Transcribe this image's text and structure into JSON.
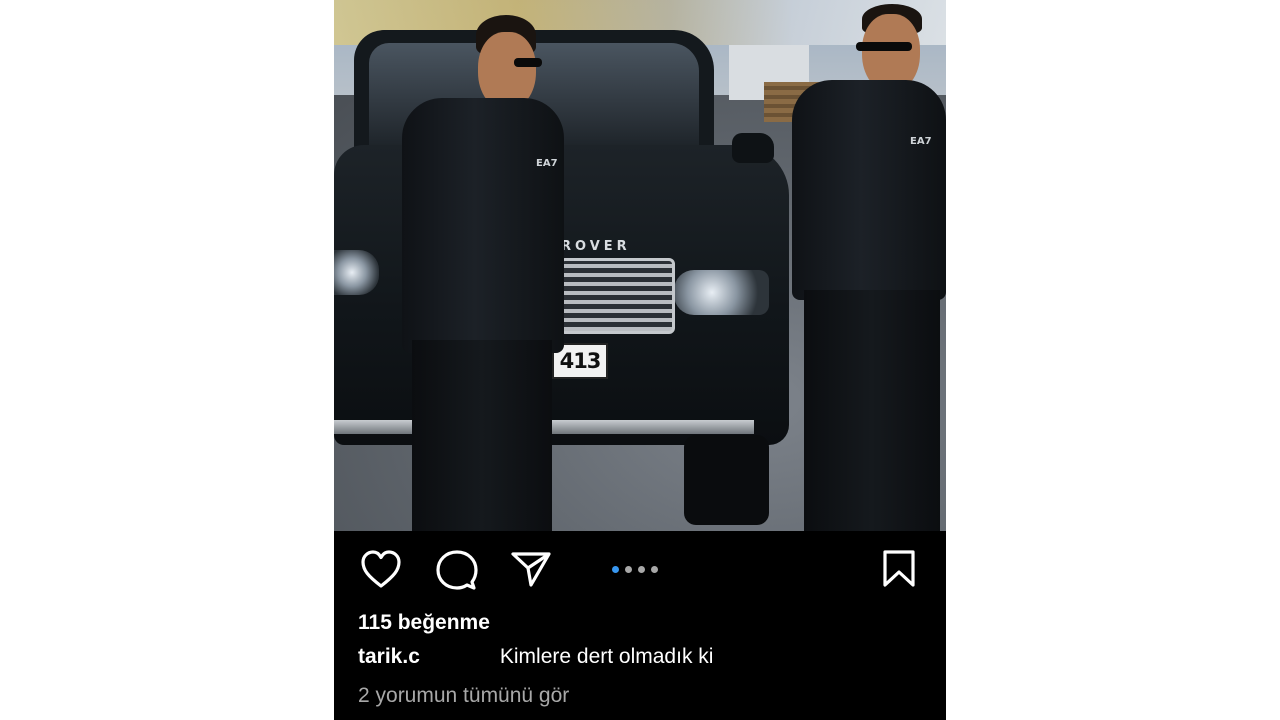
{
  "post": {
    "photo": {
      "plate_text": "413",
      "car_badge": "ROVER",
      "jacket_logo": "EA7"
    },
    "actions": {
      "like_icon": "heart-icon",
      "comment_icon": "comment-icon",
      "share_icon": "send-icon",
      "save_icon": "bookmark-icon",
      "carousel": {
        "total": 4,
        "active_index": 0
      }
    },
    "likes_text": "115 beğenme",
    "caption": {
      "username": "tarik.c",
      "text": "Kimlere dert olmadık ki"
    },
    "comments_link": "2 yorumun tümünü gör"
  },
  "colors": {
    "background": "#000000",
    "text_primary": "#ffffff",
    "text_secondary": "#a8a8a8",
    "accent_dot": "#3897f0"
  }
}
